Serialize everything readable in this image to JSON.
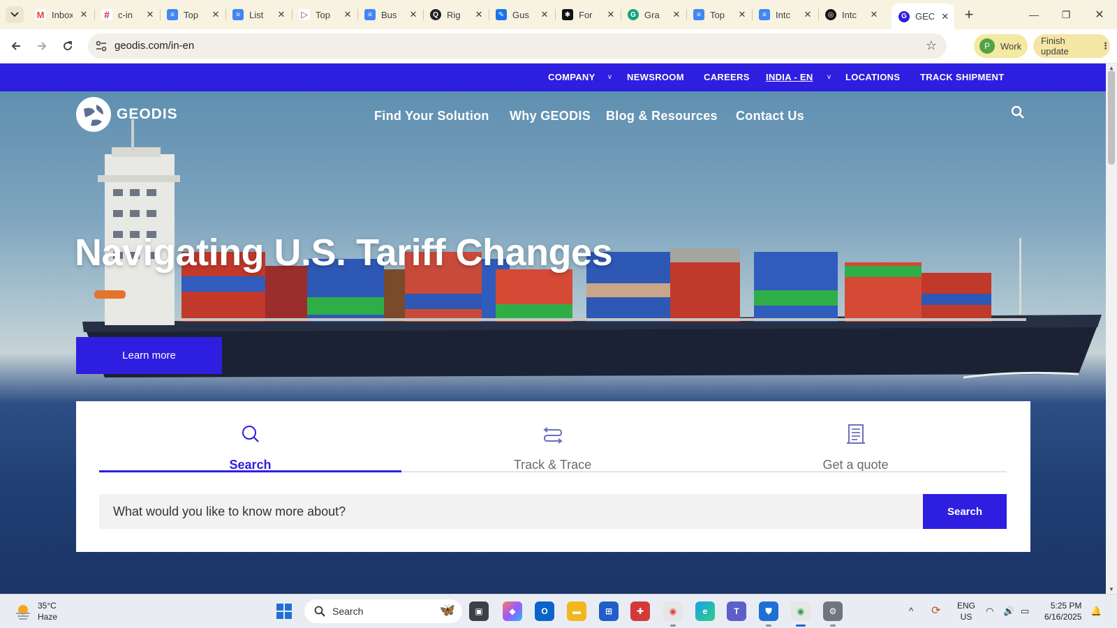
{
  "browser": {
    "tabs": [
      {
        "title": "Inbox",
        "icon": "gmail-icon",
        "color": "#ea4335",
        "glyph": "M"
      },
      {
        "title": "c-in",
        "icon": "slack-icon",
        "color": "#e01e5a",
        "glyph": "#"
      },
      {
        "title": "Top",
        "icon": "google-docs-icon",
        "color": "#4285f4",
        "glyph": "≡"
      },
      {
        "title": "List",
        "icon": "google-docs-icon",
        "color": "#4285f4",
        "glyph": "≡"
      },
      {
        "title": "Top",
        "icon": "play-icon",
        "color": "#5f5f5f",
        "glyph": "▷"
      },
      {
        "title": "Bus",
        "icon": "google-docs-icon",
        "color": "#4285f4",
        "glyph": "≡"
      },
      {
        "title": "Rig",
        "icon": "search-circle-icon",
        "color": "#222222",
        "glyph": "Q"
      },
      {
        "title": "Gus",
        "icon": "pen-icon",
        "color": "#1a73e8",
        "glyph": "✎"
      },
      {
        "title": "For",
        "icon": "dark-logo-icon",
        "color": "#111111",
        "glyph": "✱"
      },
      {
        "title": "Gra",
        "icon": "grammarly-icon",
        "color": "#15a37f",
        "glyph": "G"
      },
      {
        "title": "Top",
        "icon": "google-docs-icon",
        "color": "#4285f4",
        "glyph": "≡"
      },
      {
        "title": "Intc",
        "icon": "google-docs-icon",
        "color": "#4285f4",
        "glyph": "≡"
      },
      {
        "title": "Intc",
        "icon": "openai-icon",
        "color": "#111111",
        "glyph": "◎"
      },
      {
        "title": "GEC",
        "icon": "geodis-icon",
        "color": "#2e1ee0",
        "glyph": "G",
        "active": true
      }
    ],
    "url": "geodis.com/in-en",
    "profile_label": "Work",
    "profile_initial": "P",
    "update_label": "Finish update"
  },
  "site": {
    "utility_nav": [
      {
        "label": "COMPANY",
        "has_dropdown": true
      },
      {
        "label": "NEWSROOM"
      },
      {
        "label": "CAREERS"
      },
      {
        "label": "INDIA - EN",
        "has_dropdown": true
      },
      {
        "label": "LOCATIONS"
      },
      {
        "label": "TRACK SHIPMENT"
      }
    ],
    "brand": "GEODIS",
    "main_nav": [
      "Find Your Solution",
      "Why GEODIS",
      "Blog & Resources",
      "Contact Us"
    ],
    "hero": {
      "headline": "Navigating U.S. Tariff Changes",
      "cta": "Learn more"
    },
    "tools": {
      "tabs": [
        "Search",
        "Track & Trace",
        "Get a quote"
      ],
      "active_tab": "Search",
      "search_placeholder": "What would you like to know more about?",
      "search_button": "Search"
    },
    "accent_color": "#2e1ee0"
  },
  "taskbar": {
    "weather_temp": "35°C",
    "weather_desc": "Haze",
    "search_placeholder": "Search",
    "lang_top": "ENG",
    "lang_bottom": "US",
    "time": "5:25 PM",
    "date": "6/16/2025"
  }
}
